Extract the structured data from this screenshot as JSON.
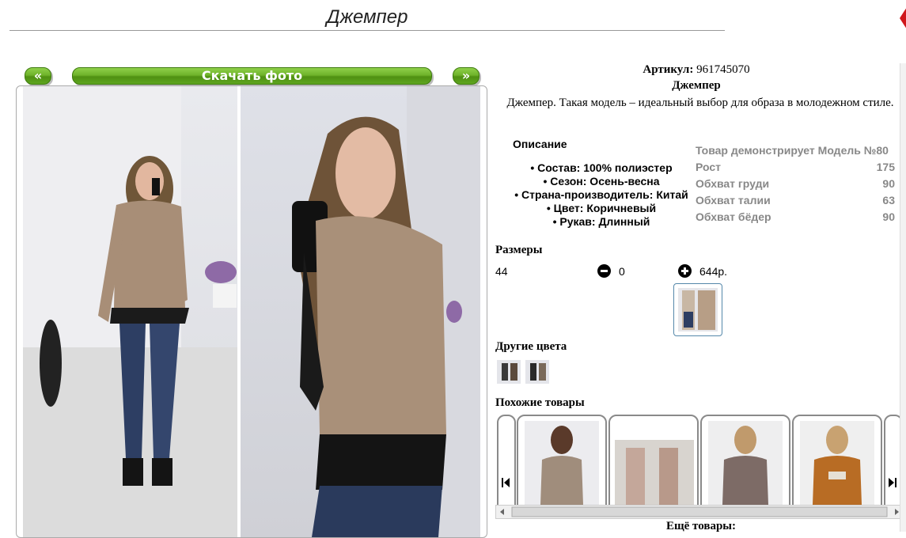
{
  "header": {
    "title": "Джемпер"
  },
  "gallery": {
    "prev_label": "«",
    "download_label": "Скачать фото",
    "next_label": "»"
  },
  "product": {
    "article_label": "Артикул:",
    "article_value": "961745070",
    "name": "Джемпер",
    "description": "Джемпер. Такая модель – идеальный выбор для образа в молодежном стиле."
  },
  "details": {
    "heading": "Описание",
    "items": [
      "Состав: 100% полиэстер",
      "Сезон: Осень-весна",
      "Страна-производитель: Китай",
      "Цвет: Коричневый",
      "Рукав: Длинный"
    ]
  },
  "model": {
    "title": "Товар демонстрирует Модель №80",
    "rows": [
      {
        "label": "Рост",
        "value": "175"
      },
      {
        "label": "Обхват груди",
        "value": "90"
      },
      {
        "label": "Обхват талии",
        "value": "63"
      },
      {
        "label": "Обхват бёдер",
        "value": "90"
      }
    ]
  },
  "sizes": {
    "heading": "Размеры",
    "size": "44",
    "quantity": "0",
    "price": "644р."
  },
  "other_colors": {
    "heading": "Другие цвета"
  },
  "similar": {
    "heading": "Похожие товары",
    "more_label": "Ещё товары:"
  },
  "colors": {
    "accent_green": "#5ea51f",
    "model_text_gray": "#888888",
    "card_border": "#8a8a8a"
  }
}
